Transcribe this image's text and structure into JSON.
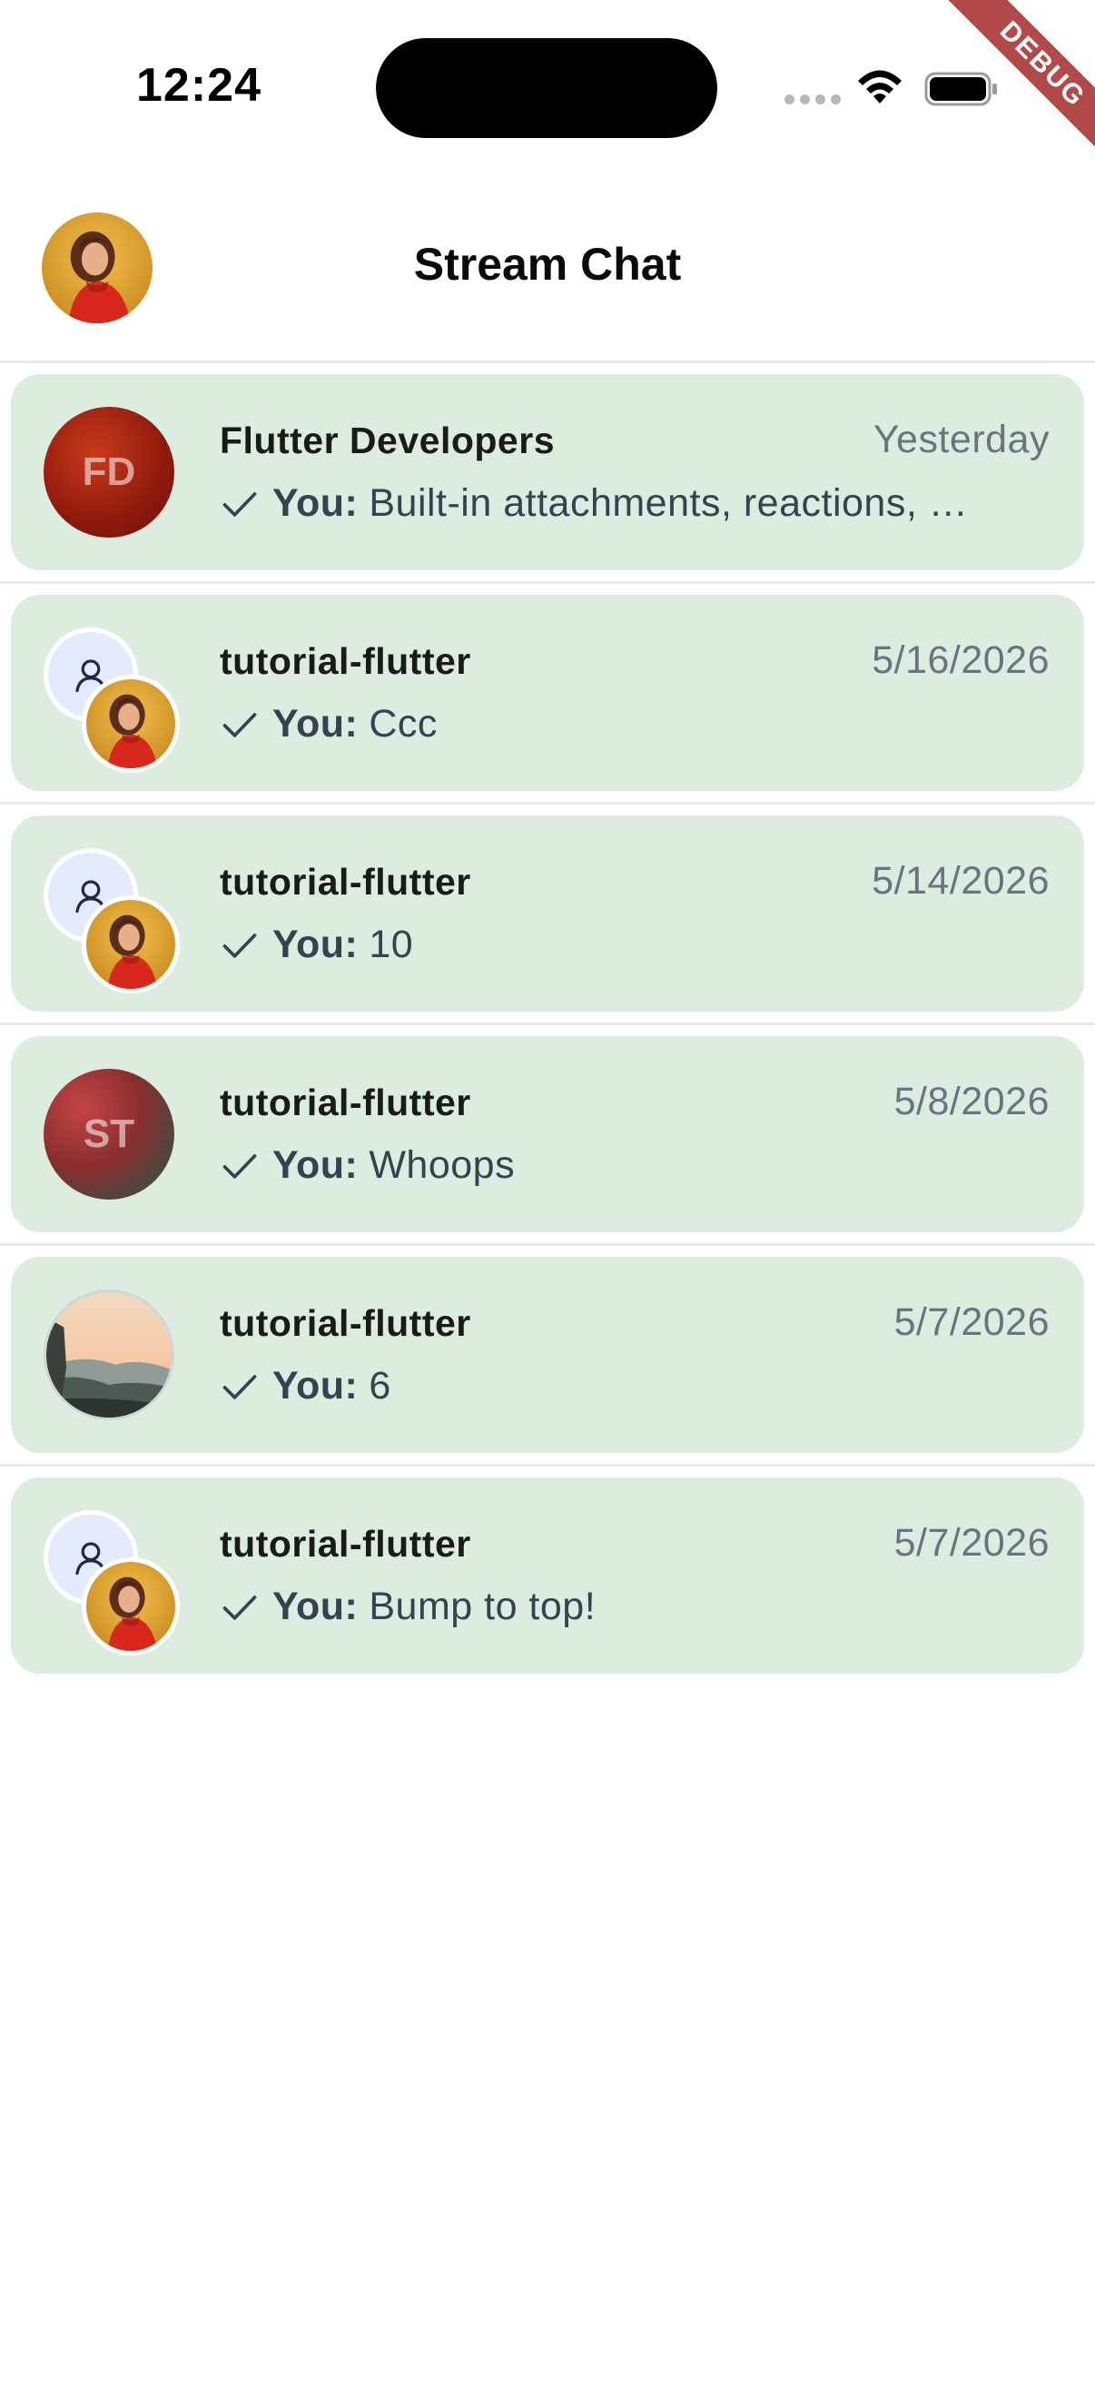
{
  "status_bar": {
    "time": "12:24"
  },
  "debug_banner": "DEBUG",
  "header": {
    "title": "Stream Chat"
  },
  "channels": [
    {
      "title": "Flutter Developers",
      "date": "Yesterday",
      "sender": "You:",
      "message": "Built-in attachments, reactions, …",
      "avatar": "initials",
      "initials": "FD"
    },
    {
      "title": "tutorial-flutter",
      "date": "5/16/2026",
      "sender": "You:",
      "message": "Ccc",
      "avatar": "group-stack"
    },
    {
      "title": "tutorial-flutter",
      "date": "5/14/2026",
      "sender": "You:",
      "message": "10",
      "avatar": "group-stack"
    },
    {
      "title": "tutorial-flutter",
      "date": "5/8/2026",
      "sender": "You:",
      "message": "Whoops",
      "avatar": "initials",
      "initials": "ST"
    },
    {
      "title": "tutorial-flutter",
      "date": "5/7/2026",
      "sender": "You:",
      "message": "6",
      "avatar": "landscape-photo"
    },
    {
      "title": "tutorial-flutter",
      "date": "5/7/2026",
      "sender": "You:",
      "message": "Bump to top!",
      "avatar": "group-stack"
    }
  ],
  "colors": {
    "channel_bg": "#dcede0",
    "date": "#6b7280",
    "preview": "#374151",
    "ribbon": "#b24a4a"
  }
}
